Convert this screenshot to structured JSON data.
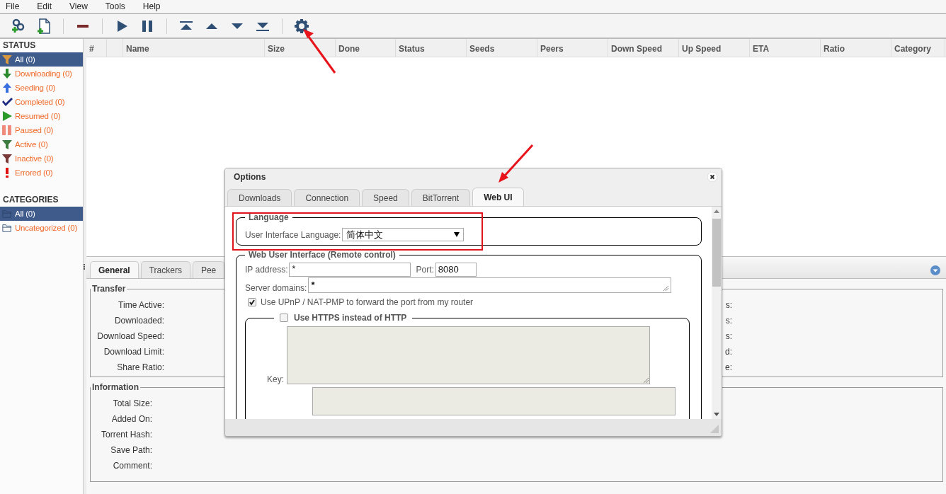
{
  "menu": [
    "File",
    "Edit",
    "View",
    "Tools",
    "Help"
  ],
  "sidebar": {
    "status_title": "STATUS",
    "status_items": [
      {
        "label": "All (0)",
        "kind": "all",
        "selected": true
      },
      {
        "label": "Downloading (0)",
        "kind": "downloading",
        "selected": false
      },
      {
        "label": "Seeding (0)",
        "kind": "seeding",
        "selected": false
      },
      {
        "label": "Completed (0)",
        "kind": "completed",
        "selected": false
      },
      {
        "label": "Resumed (0)",
        "kind": "resumed",
        "selected": false
      },
      {
        "label": "Paused (0)",
        "kind": "paused",
        "selected": false
      },
      {
        "label": "Active (0)",
        "kind": "active",
        "selected": false
      },
      {
        "label": "Inactive (0)",
        "kind": "inactive",
        "selected": false
      },
      {
        "label": "Errored (0)",
        "kind": "errored",
        "selected": false
      }
    ],
    "categories_title": "CATEGORIES",
    "category_items": [
      {
        "label": "All (0)",
        "selected": true
      },
      {
        "label": "Uncategorized (0)",
        "selected": false
      }
    ]
  },
  "table": {
    "columns": [
      "#",
      "Name",
      "Size",
      "Done",
      "Status",
      "Seeds",
      "Peers",
      "Down Speed",
      "Up Speed",
      "ETA",
      "Ratio",
      "Category"
    ]
  },
  "details": {
    "tabs": [
      {
        "label": "General",
        "selected": true
      },
      {
        "label": "Trackers",
        "selected": false
      },
      {
        "label": "Pee",
        "selected": false
      }
    ],
    "transfer": {
      "title": "Transfer",
      "labels": [
        "Time Active:",
        "Downloaded:",
        "Download Speed:",
        "Download Limit:",
        "Share Ratio:"
      ],
      "right_labels": [
        "s:",
        "s:",
        "s:",
        "d:",
        "e:"
      ]
    },
    "information": {
      "title": "Information",
      "labels": [
        "Total Size:",
        "Added On:",
        "Torrent Hash:",
        "Save Path:",
        "Comment:"
      ]
    }
  },
  "dialog": {
    "title": "Options",
    "tabs": [
      {
        "label": "Downloads",
        "selected": false
      },
      {
        "label": "Connection",
        "selected": false
      },
      {
        "label": "Speed",
        "selected": false
      },
      {
        "label": "BitTorrent",
        "selected": false
      },
      {
        "label": "Web UI",
        "selected": true
      }
    ],
    "language": {
      "legend": "Language",
      "label": "User Interface Language:",
      "value": "简体中文"
    },
    "web_ui": {
      "legend": "Web User Interface (Remote control)",
      "ip_label": "IP address:",
      "ip_value": "*",
      "port_label": "Port:",
      "port_value": "8080",
      "domains_label": "Server domains:",
      "domains_value": "*",
      "upnp": {
        "label": "Use UPnP / NAT-PMP to forward the port from my router",
        "checked": true
      },
      "https": {
        "label": "Use HTTPS instead of HTTP",
        "checked": false
      },
      "key_label": "Key:"
    }
  }
}
